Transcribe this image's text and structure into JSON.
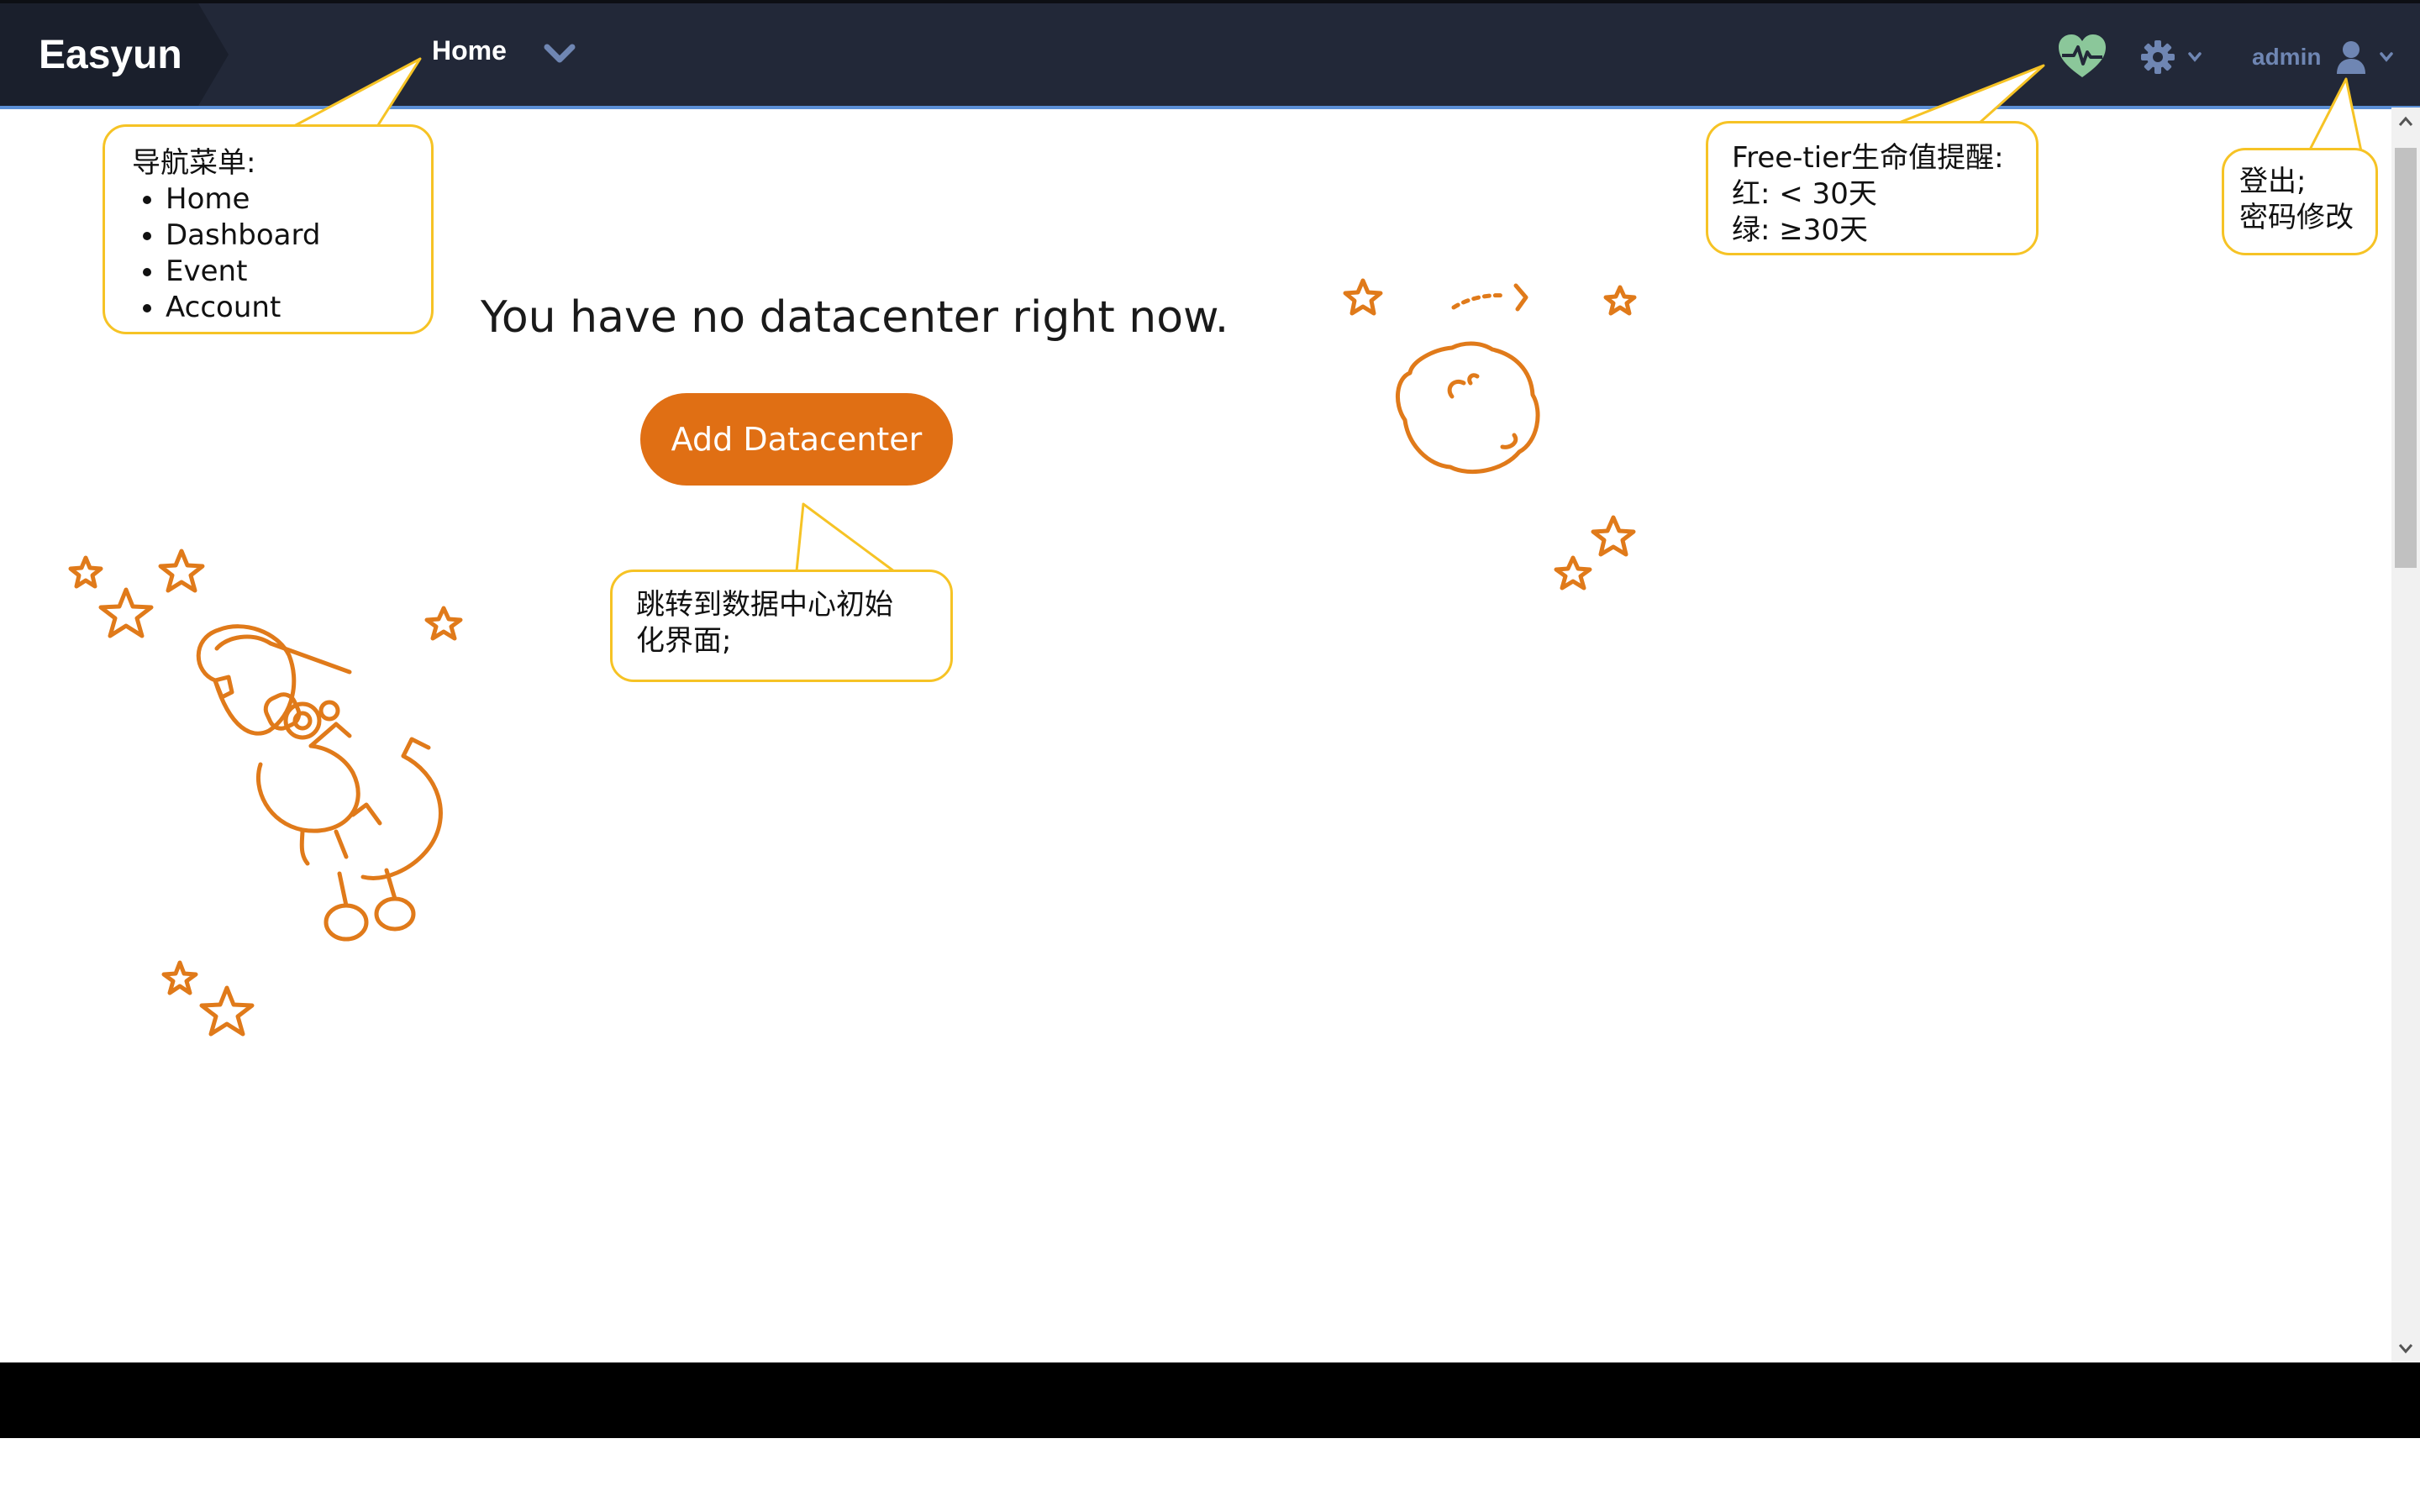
{
  "app": {
    "brand": "Easyun"
  },
  "nav": {
    "home_label": "Home"
  },
  "header": {
    "user_name": "admin"
  },
  "main": {
    "empty_message": "You have no datacenter right now.",
    "add_button_label": "Add Datacenter"
  },
  "callouts": {
    "nav": {
      "title": "导航菜单:",
      "items": [
        "Home",
        "Dashboard",
        "Event",
        "Account"
      ]
    },
    "health": {
      "lines": [
        "Free-tier生命值提醒:",
        "红:   < 30天",
        "绿:   ≥30天"
      ]
    },
    "user": {
      "lines": [
        "登出;",
        "密码修改"
      ]
    },
    "add": {
      "lines": [
        "跳转到数据中心初始",
        "化界面;"
      ]
    }
  },
  "icons": {
    "nav_dropdown": "chevron-down-icon",
    "health": "heart-pulse-icon",
    "settings": "gear-icon",
    "user": "user-icon",
    "caret": "caret-down-icon"
  },
  "colors": {
    "navbar_bg": "#222838",
    "accent_line": "#5b8fd6",
    "button_orange": "#e06f14",
    "illustration_orange": "#e07a1a",
    "health_green": "#8bc79a",
    "callout_border": "#f6c325"
  }
}
